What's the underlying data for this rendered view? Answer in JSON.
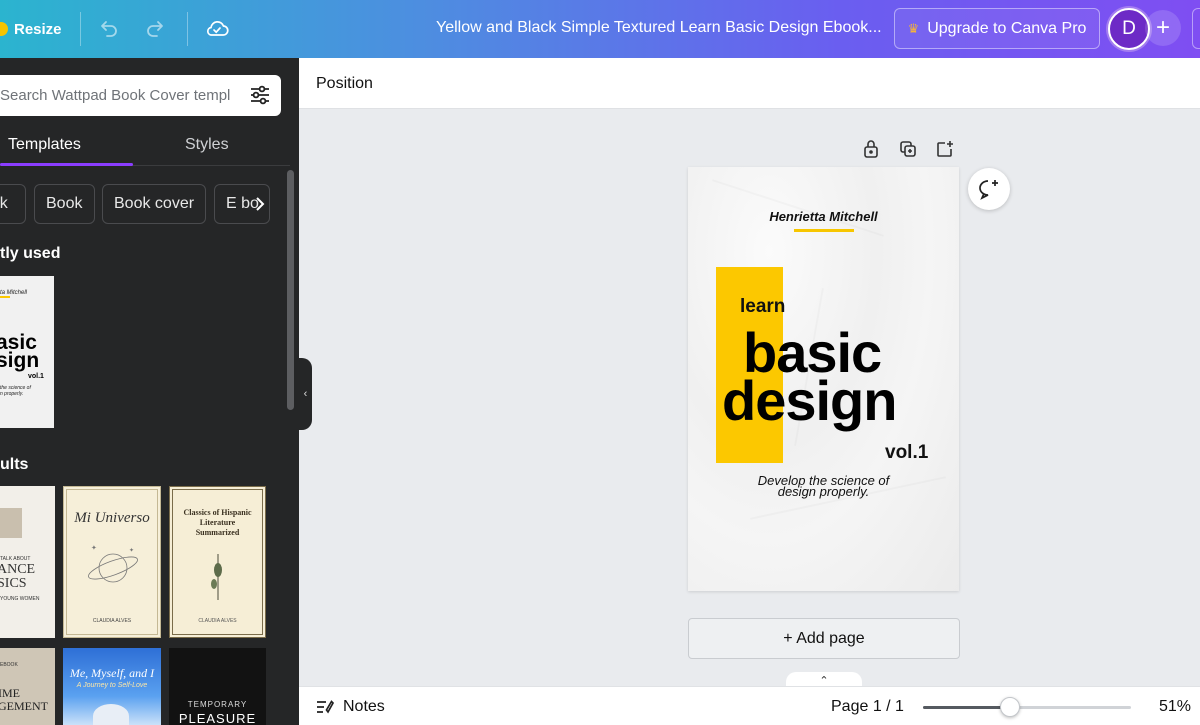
{
  "topbar": {
    "resize_label": "Resize",
    "title": "Yellow and Black Simple Textured Learn Basic Design Ebook...",
    "upgrade_label": "Upgrade to Canva Pro",
    "avatar_initial": "D",
    "plus_label": "+",
    "icons": [
      "undo-icon",
      "redo-icon",
      "cloud-saved-icon"
    ]
  },
  "sidebar": {
    "search_placeholder": "Search Wattpad Book Cover templ",
    "tabs": [
      {
        "label": "Templates",
        "active": true
      },
      {
        "label": "Styles",
        "active": false
      }
    ],
    "chips": [
      "ook",
      "Book",
      "Book cover",
      "E bo"
    ],
    "recently_used_title": "tly used",
    "results_title": "ults",
    "recent_thumb": {
      "author": "ta Mitchell",
      "line1": "asic",
      "line2": "sign",
      "vol": "vol.1",
      "tagline1": "the science of",
      "tagline2": "n properly."
    },
    "results": [
      {
        "lines": [
          "TALK ABOUT",
          "ANCE",
          "SICS",
          "YOUNG WOMEN"
        ]
      },
      {
        "title": "Mi Universo",
        "author": "CLAUDIA ALVES"
      },
      {
        "title": "Classics of Hispanic Literature Summarized",
        "author": "CLAUDIA ALVES"
      },
      {
        "lines": [
          "EBOOK",
          "IME",
          "GEMENT"
        ]
      },
      {
        "title": "Me, Myself, and I",
        "subtitle": "A Journey to Self-Love"
      },
      {
        "title": "TEMPORARY",
        "subtitle": "PLEASURE"
      }
    ]
  },
  "editor": {
    "position_label": "Position",
    "page": {
      "author": "Henrietta Mitchell",
      "learn": "learn",
      "basic": "basic",
      "design": "design",
      "vol": "vol.1",
      "tagline_1": "Develop the science of",
      "tagline_2": "design properly."
    },
    "add_page_label": "+ Add page"
  },
  "bottombar": {
    "notes_label": "Notes",
    "page_label": "Page 1 / 1",
    "zoom_label": "51%",
    "zoom_value": 0.42
  },
  "colors": {
    "accent": "#8b3dff",
    "yellow": "#fcc800",
    "panel": "#252627"
  }
}
